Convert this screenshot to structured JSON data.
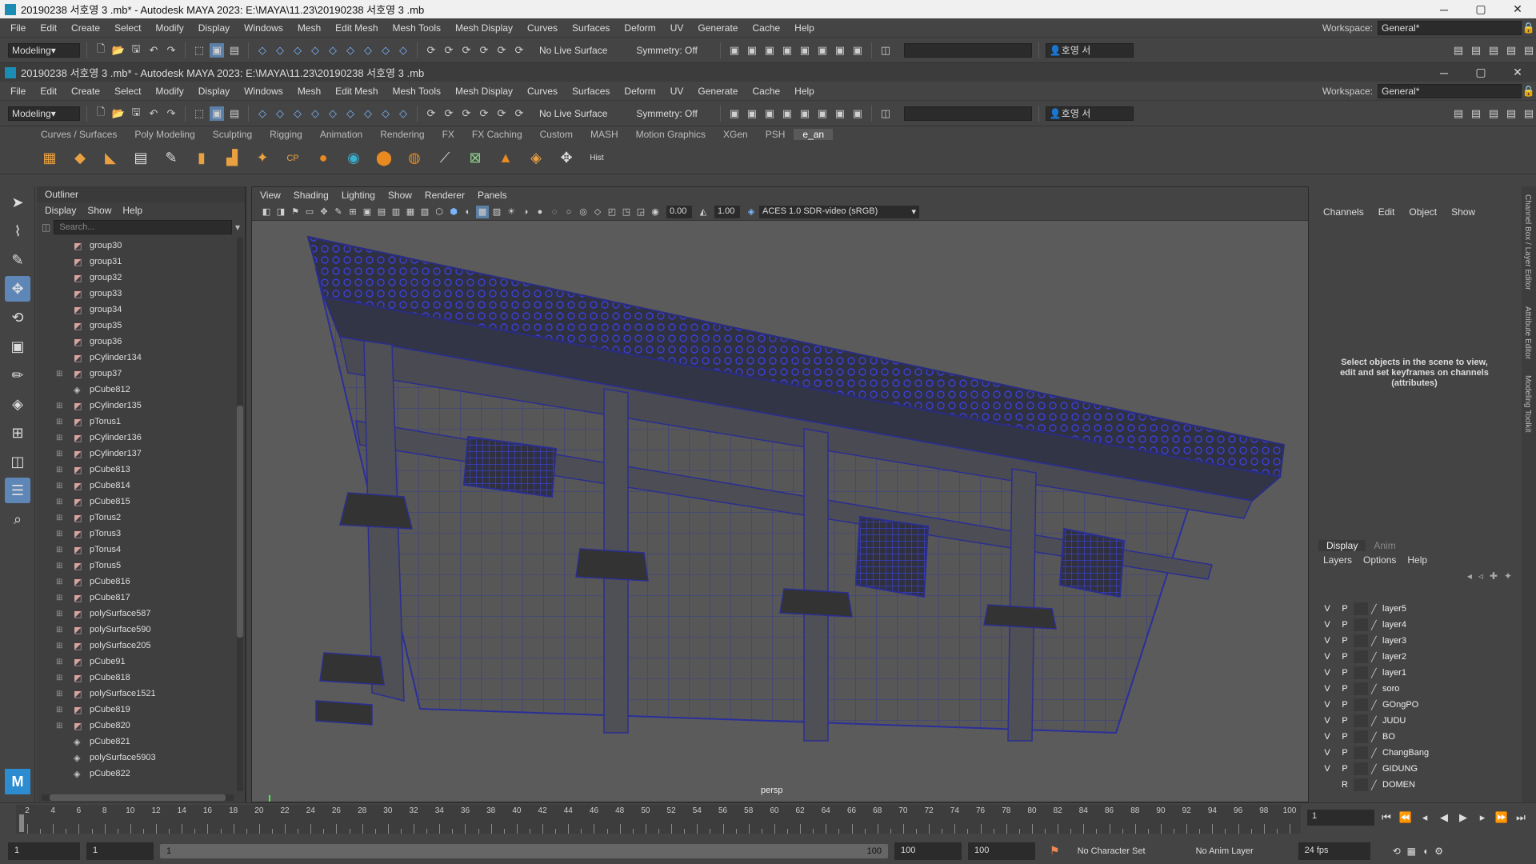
{
  "window": {
    "title": "20190238 서호영 3 .mb* - Autodesk MAYA 2023: E:\\MAYA\\11.23\\20190238 서호영 3 .mb",
    "min": "─",
    "max": "▢",
    "close": "✕"
  },
  "menu": [
    "File",
    "Edit",
    "Create",
    "Select",
    "Modify",
    "Display",
    "Windows",
    "Mesh",
    "Edit Mesh",
    "Mesh Tools",
    "Mesh Display",
    "Curves",
    "Surfaces",
    "Deform",
    "UV",
    "Generate",
    "Cache",
    "Help"
  ],
  "workspace": {
    "label": "Workspace:",
    "value": "General*"
  },
  "statusline": {
    "mode": "Modeling",
    "live_surface": "No Live Surface",
    "symmetry": "Symmetry: Off",
    "user": "호영 서"
  },
  "shelf_tabs": [
    "Curves / Surfaces",
    "Poly Modeling",
    "Sculpting",
    "Rigging",
    "Animation",
    "Rendering",
    "FX",
    "FX Caching",
    "Custom",
    "MASH",
    "Motion Graphics",
    "XGen",
    "PSH",
    "e_an"
  ],
  "shelf_active": "e_an",
  "shelf_labels": {
    "cp": "CP",
    "hist": "Hist"
  },
  "outliner": {
    "title": "Outliner",
    "menu": [
      "Display",
      "Show",
      "Help"
    ],
    "search_placeholder": "Search...",
    "items": [
      {
        "name": "group30",
        "expand": false,
        "icon": "group"
      },
      {
        "name": "group31",
        "expand": false,
        "icon": "group"
      },
      {
        "name": "group32",
        "expand": false,
        "icon": "group"
      },
      {
        "name": "group33",
        "expand": false,
        "icon": "group"
      },
      {
        "name": "group34",
        "expand": false,
        "icon": "group"
      },
      {
        "name": "group35",
        "expand": false,
        "icon": "group"
      },
      {
        "name": "group36",
        "expand": false,
        "icon": "group"
      },
      {
        "name": "pCylinder134",
        "expand": false,
        "icon": "group"
      },
      {
        "name": "group37",
        "expand": true,
        "icon": "group"
      },
      {
        "name": "pCube812",
        "expand": false,
        "icon": "mesh"
      },
      {
        "name": "pCylinder135",
        "expand": true,
        "icon": "group"
      },
      {
        "name": "pTorus1",
        "expand": true,
        "icon": "group"
      },
      {
        "name": "pCylinder136",
        "expand": true,
        "icon": "group"
      },
      {
        "name": "pCylinder137",
        "expand": true,
        "icon": "group"
      },
      {
        "name": "pCube813",
        "expand": true,
        "icon": "group"
      },
      {
        "name": "pCube814",
        "expand": true,
        "icon": "group"
      },
      {
        "name": "pCube815",
        "expand": true,
        "icon": "group"
      },
      {
        "name": "pTorus2",
        "expand": true,
        "icon": "group"
      },
      {
        "name": "pTorus3",
        "expand": true,
        "icon": "group"
      },
      {
        "name": "pTorus4",
        "expand": true,
        "icon": "group"
      },
      {
        "name": "pTorus5",
        "expand": true,
        "icon": "group"
      },
      {
        "name": "pCube816",
        "expand": true,
        "icon": "group"
      },
      {
        "name": "pCube817",
        "expand": true,
        "icon": "group"
      },
      {
        "name": "polySurface587",
        "expand": true,
        "icon": "group"
      },
      {
        "name": "polySurface590",
        "expand": true,
        "icon": "group"
      },
      {
        "name": "polySurface205",
        "expand": true,
        "icon": "group"
      },
      {
        "name": "pCube91",
        "expand": true,
        "icon": "group"
      },
      {
        "name": "pCube818",
        "expand": true,
        "icon": "group"
      },
      {
        "name": "polySurface1521",
        "expand": true,
        "icon": "group"
      },
      {
        "name": "pCube819",
        "expand": true,
        "icon": "group"
      },
      {
        "name": "pCube820",
        "expand": true,
        "icon": "group"
      },
      {
        "name": "pCube821",
        "expand": false,
        "icon": "mesh"
      },
      {
        "name": "polySurface5903",
        "expand": false,
        "icon": "mesh"
      },
      {
        "name": "pCube822",
        "expand": false,
        "icon": "mesh"
      }
    ]
  },
  "viewport": {
    "menu": [
      "View",
      "Shading",
      "Lighting",
      "Show",
      "Renderer",
      "Panels"
    ],
    "exposure": "0.00",
    "gamma": "1.00",
    "color_space": "ACES 1.0 SDR-video (sRGB)",
    "camera": "persp"
  },
  "channel_box": {
    "menu": [
      "Channels",
      "Edit",
      "Object",
      "Show"
    ],
    "message": "Select objects in the scene to view, edit and set keyframes on channels (attributes)",
    "side_tabs": [
      "Channel Box / Layer Editor",
      "Attribute Editor",
      "Modeling Toolkit"
    ]
  },
  "layer_editor": {
    "tabs": [
      "Display",
      "Anim"
    ],
    "menu": [
      "Layers",
      "Options",
      "Help"
    ],
    "layers": [
      {
        "v": "V",
        "p": "P",
        "name": "layer5"
      },
      {
        "v": "V",
        "p": "P",
        "name": "layer4"
      },
      {
        "v": "V",
        "p": "P",
        "name": "layer3"
      },
      {
        "v": "V",
        "p": "P",
        "name": "layer2"
      },
      {
        "v": "V",
        "p": "P",
        "name": "layer1"
      },
      {
        "v": "V",
        "p": "P",
        "name": "soro"
      },
      {
        "v": "V",
        "p": "P",
        "name": "GOngPO"
      },
      {
        "v": "V",
        "p": "P",
        "name": "JUDU"
      },
      {
        "v": "V",
        "p": "P",
        "name": "BO"
      },
      {
        "v": "V",
        "p": "P",
        "name": "ChangBang"
      },
      {
        "v": "V",
        "p": "P",
        "name": "GIDUNG"
      },
      {
        "v": "",
        "p": "R",
        "name": "DOMEN"
      }
    ]
  },
  "timeline": {
    "labels": [
      "2",
      "4",
      "6",
      "8",
      "10",
      "12",
      "14",
      "16",
      "18",
      "20",
      "22",
      "24",
      "26",
      "28",
      "30",
      "32",
      "34",
      "36",
      "38",
      "40",
      "42",
      "44",
      "46",
      "48",
      "50",
      "52",
      "54",
      "56",
      "58",
      "60",
      "62",
      "64",
      "66",
      "68",
      "70",
      "72",
      "74",
      "76",
      "78",
      "80",
      "82",
      "84",
      "86",
      "88",
      "90",
      "92",
      "94",
      "96",
      "98",
      "100"
    ],
    "current_frame": "1"
  },
  "range": {
    "start": "1",
    "playback_start": "1",
    "slider_start": "1",
    "slider_end": "100",
    "playback_end": "100",
    "end": "100",
    "character_set": "No Character Set",
    "anim_layer": "No Anim Layer",
    "fps": "24 fps"
  }
}
